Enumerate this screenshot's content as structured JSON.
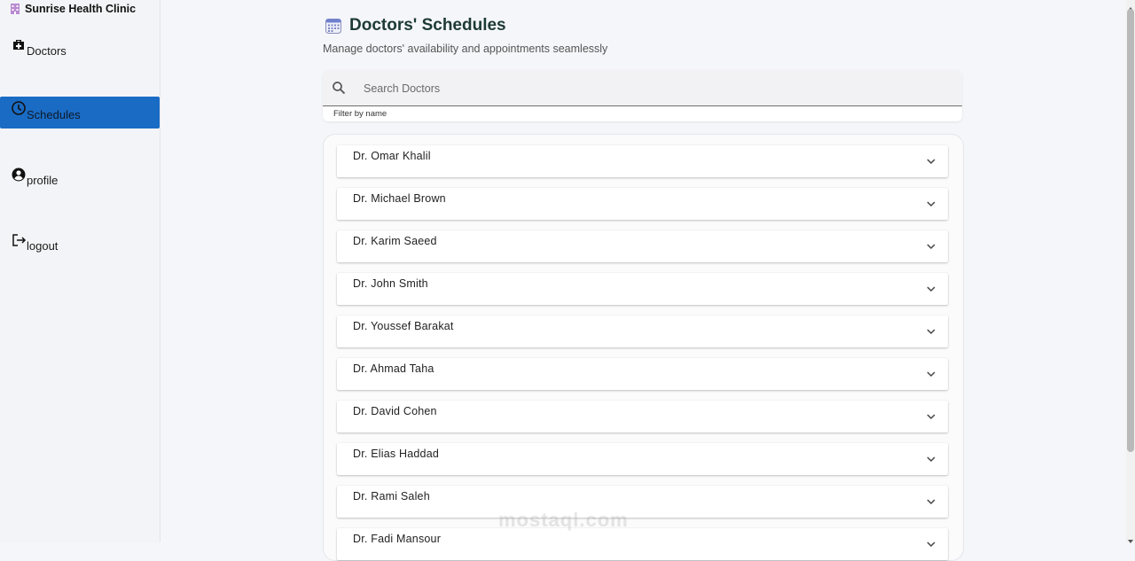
{
  "brand": {
    "name": "Sunrise Health Clinic",
    "icon": "hospital-icon"
  },
  "sidebar": {
    "items": [
      {
        "label": "Doctors",
        "icon": "medical-bag-icon",
        "active": false
      },
      {
        "label": "Schedules",
        "icon": "clock-icon",
        "active": true
      },
      {
        "label": "profile",
        "icon": "account-circle-icon",
        "active": false
      },
      {
        "label": "logout",
        "icon": "logout-icon",
        "active": false
      }
    ]
  },
  "header": {
    "title": "Doctors' Schedules",
    "title_icon": "calendar-icon",
    "subtitle": "Manage doctors' availability and appointments seamlessly"
  },
  "search": {
    "placeholder": "Search Doctors",
    "value": "",
    "helper": "Filter by name",
    "icon": "search-icon"
  },
  "doctors": [
    "Dr. Omar Khalil",
    "Dr. Michael Brown",
    "Dr. Karim Saeed",
    "Dr. John Smith",
    "Dr. Youssef Barakat",
    "Dr. Ahmad Taha",
    "Dr. David Cohen",
    "Dr. Elias Haddad",
    "Dr. Rami Saleh",
    "Dr. Fadi Mansour"
  ],
  "watermark": "mostaql.com",
  "colors": {
    "active_nav": "#1a6bc4",
    "title": "#1d3a34",
    "background": "#f5f6fa"
  }
}
